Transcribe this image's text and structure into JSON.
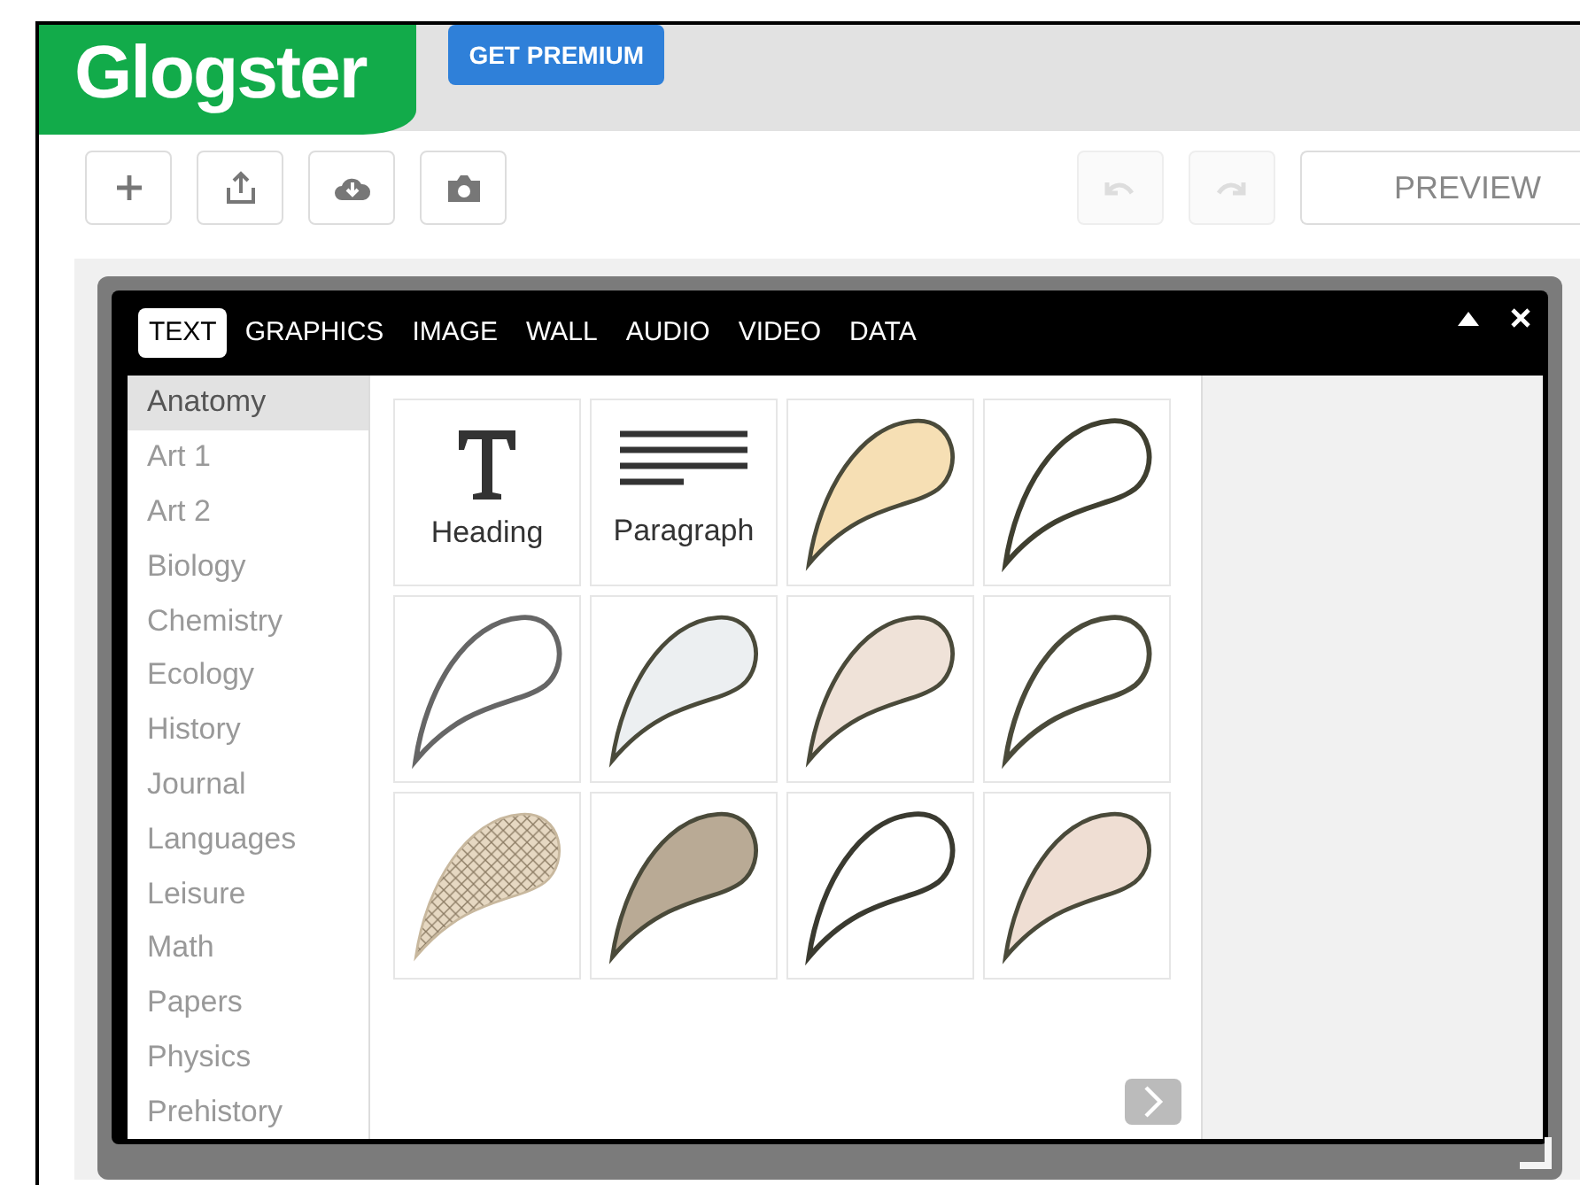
{
  "header": {
    "logo": "Glogster",
    "premium_button": "GET PREMIUM"
  },
  "toolbar": {
    "preview_button": "PREVIEW"
  },
  "panel": {
    "tabs": [
      {
        "label": "TEXT",
        "selected": true
      },
      {
        "label": "GRAPHICS",
        "selected": false
      },
      {
        "label": "IMAGE",
        "selected": false
      },
      {
        "label": "WALL",
        "selected": false
      },
      {
        "label": "AUDIO",
        "selected": false
      },
      {
        "label": "VIDEO",
        "selected": false
      },
      {
        "label": "DATA",
        "selected": false
      }
    ],
    "categories": [
      {
        "label": "Anatomy",
        "selected": true
      },
      {
        "label": "Art 1",
        "selected": false
      },
      {
        "label": "Art 2",
        "selected": false
      },
      {
        "label": "Biology",
        "selected": false
      },
      {
        "label": "Chemistry",
        "selected": false
      },
      {
        "label": "Ecology",
        "selected": false
      },
      {
        "label": "History",
        "selected": false
      },
      {
        "label": "Journal",
        "selected": false
      },
      {
        "label": "Languages",
        "selected": false
      },
      {
        "label": "Leisure",
        "selected": false
      },
      {
        "label": "Math",
        "selected": false
      },
      {
        "label": "Papers",
        "selected": false
      },
      {
        "label": "Physics",
        "selected": false
      },
      {
        "label": "Prehistory",
        "selected": false
      }
    ],
    "items": [
      {
        "kind": "heading",
        "label": "Heading"
      },
      {
        "kind": "paragraph",
        "label": "Paragraph"
      },
      {
        "kind": "shape",
        "color": "#f6dfb4"
      },
      {
        "kind": "outline",
        "color": "#3f3f30"
      },
      {
        "kind": "outline",
        "color": "#666666"
      },
      {
        "kind": "shape",
        "color": "#eceff1"
      },
      {
        "kind": "shape",
        "color": "#efe2d8"
      },
      {
        "kind": "outline",
        "color": "#4a4a3a"
      },
      {
        "kind": "pattern",
        "color": "#e6d8c2"
      },
      {
        "kind": "shape",
        "color": "#b9aa95"
      },
      {
        "kind": "outline",
        "color": "#3a3a30"
      },
      {
        "kind": "shape",
        "color": "#efded3"
      }
    ]
  }
}
